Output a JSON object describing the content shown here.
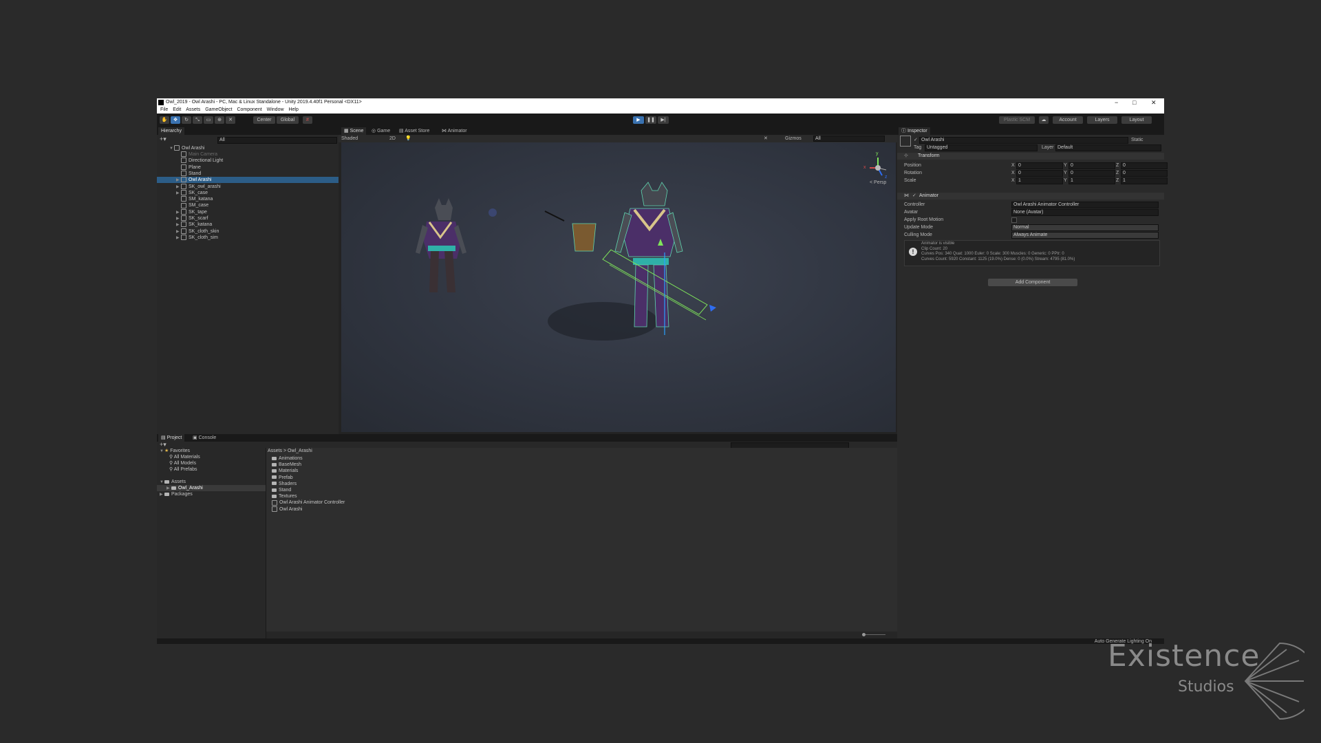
{
  "window": {
    "title": "Owl_2019 - Owl Arashi - PC, Mac & Linux Standalone - Unity 2019.4.40f1 Personal <DX11>",
    "minimize": "−",
    "maximize": "□",
    "close": "✕"
  },
  "menu": [
    "File",
    "Edit",
    "Assets",
    "GameObject",
    "Component",
    "Window",
    "Help"
  ],
  "toolbar": {
    "pivot": "Center",
    "space": "Global",
    "plastic": "Plastic SCM",
    "account": "Account",
    "layers": "Layers",
    "layout": "Layout",
    "play_icon": "play-icon",
    "pause_icon": "pause-icon",
    "step_icon": "step-icon"
  },
  "hierarchy": {
    "tab": "Hierarchy",
    "search_placeholder": "All",
    "root": "Owl Arashi",
    "items": [
      {
        "label": "Main Camera",
        "dim": true,
        "arrow": false
      },
      {
        "label": "Directional Light",
        "dim": false,
        "arrow": false
      },
      {
        "label": "Plane",
        "dim": false,
        "arrow": false
      },
      {
        "label": "Stand",
        "dim": false,
        "arrow": false
      },
      {
        "label": "Owl Arashi",
        "dim": false,
        "arrow": true,
        "selected": true
      },
      {
        "label": "SK_owl_arashi",
        "dim": false,
        "arrow": true
      },
      {
        "label": "SK_case",
        "dim": false,
        "arrow": true
      },
      {
        "label": "SM_katana",
        "dim": false,
        "arrow": false
      },
      {
        "label": "SM_case",
        "dim": false,
        "arrow": false
      },
      {
        "label": "SK_tape",
        "dim": false,
        "arrow": true
      },
      {
        "label": "SK_scarf",
        "dim": false,
        "arrow": true
      },
      {
        "label": "SK_katana",
        "dim": false,
        "arrow": true
      },
      {
        "label": "SK_cloth_skin",
        "dim": false,
        "arrow": true
      },
      {
        "label": "SK_cloth_sim",
        "dim": false,
        "arrow": true
      }
    ]
  },
  "scene": {
    "tabs": [
      "Scene",
      "Game",
      "Asset Store",
      "Animator"
    ],
    "shading": "Shaded",
    "mode2d": "2D",
    "gizmos": "Gizmos",
    "search_placeholder": "All",
    "persp": "< Persp",
    "axes": {
      "x": "x",
      "y": "y",
      "z": "z"
    }
  },
  "inspector": {
    "tab": "Inspector",
    "object_name": "Owl Arashi",
    "static_label": "Static",
    "tag_label": "Tag",
    "tag_value": "Untagged",
    "layer_label": "Layer",
    "layer_value": "Default",
    "transform": {
      "title": "Transform",
      "position_label": "Position",
      "rotation_label": "Rotation",
      "scale_label": "Scale",
      "axis_x": "X",
      "axis_y": "Y",
      "axis_z": "Z",
      "position": [
        "0",
        "0",
        "0"
      ],
      "rotation": [
        "0",
        "0",
        "0"
      ],
      "scale": [
        "1",
        "1",
        "1"
      ]
    },
    "animator": {
      "title": "Animator",
      "controller_label": "Controller",
      "controller_value": "Owl Arashi Animator Controller",
      "avatar_label": "Avatar",
      "avatar_value": "None (Avatar)",
      "root_motion_label": "Apply Root Motion",
      "update_label": "Update Mode",
      "update_value": "Normal",
      "culling_label": "Culling Mode",
      "culling_value": "Always Animate",
      "info_lines": [
        "Animator is visible",
        "Clip Count: 20",
        "Curves Pos: 340 Quat: 1000 Euler: 0 Scale: 300 Muscles: 0 Generic: 0 PPtr: 0",
        "Curves Count: 5920 Constant: 1125 (19.0%) Dense: 0 (0.0%) Stream: 4795 (81.0%)"
      ]
    },
    "add_component": "Add Component"
  },
  "project": {
    "tabs": [
      "Project",
      "Console"
    ],
    "favorites_label": "Favorites",
    "favorites": [
      "All Materials",
      "All Models",
      "All Prefabs"
    ],
    "assets_label": "Assets",
    "assets_child": "Owl_Arashi",
    "packages_label": "Packages",
    "breadcrumb_root": "Assets",
    "breadcrumb_sep": ">",
    "breadcrumb_leaf": "Owl_Arashi",
    "folders": [
      "Animations",
      "BaseMesh",
      "Materials",
      "Prefab",
      "Shaders",
      "Stand",
      "Textures"
    ],
    "files": [
      "Owl Arashi Animator Controller",
      "Owl Arashi"
    ]
  },
  "status": "Auto Generate Lighting On",
  "watermark": {
    "line1": "Existence",
    "line2": "Studios"
  }
}
